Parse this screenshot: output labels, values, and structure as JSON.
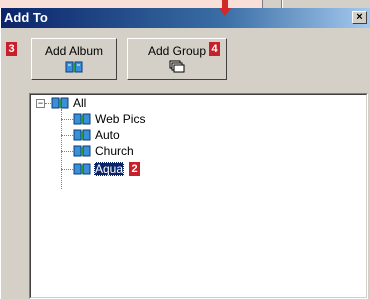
{
  "dialog": {
    "title": "Add To",
    "close_glyph": "×"
  },
  "toolbar": {
    "add_album": {
      "label": "Add Album",
      "icon": "album-book-icon"
    },
    "add_group": {
      "label": "Add Group",
      "icon": "group-stack-icon"
    }
  },
  "callouts": [
    "3",
    "4",
    "2"
  ],
  "tree": {
    "root": {
      "label": "All",
      "expander": "−",
      "expanded": true,
      "icon": "album-book-icon"
    },
    "items": [
      {
        "label": "Web Pics",
        "icon": "album-book-icon",
        "selected": false
      },
      {
        "label": "Auto",
        "icon": "album-book-icon",
        "selected": false
      },
      {
        "label": "Church",
        "icon": "album-book-icon",
        "selected": false
      },
      {
        "label": "Aqua",
        "icon": "album-book-icon",
        "selected": true
      }
    ]
  },
  "colors": {
    "title_bar": "#0a246a",
    "callout": "#c8202a",
    "selection": "#0a246a",
    "background": "#f8dfd7"
  }
}
